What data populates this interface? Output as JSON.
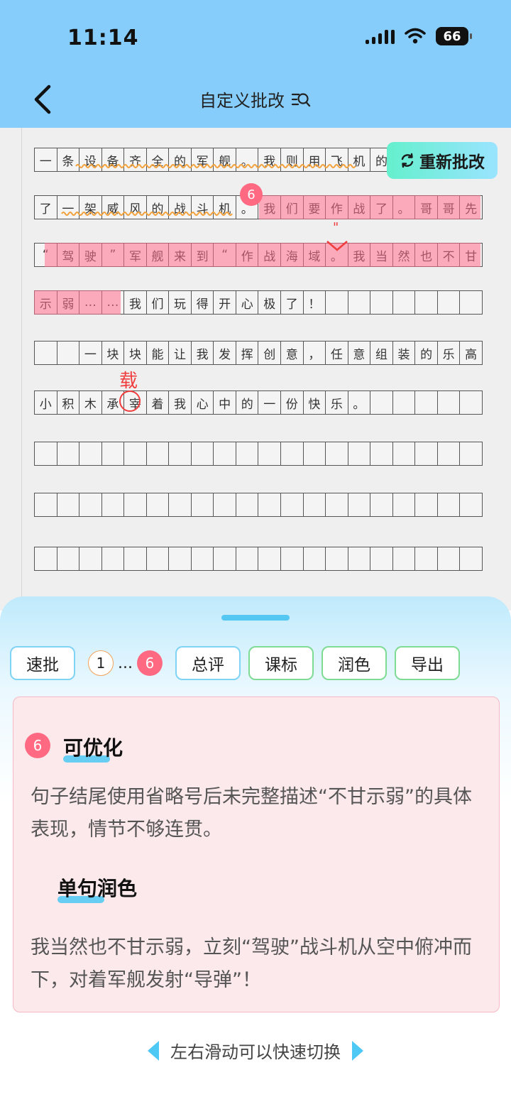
{
  "status_bar": {
    "time": "11:14",
    "battery": "66"
  },
  "header": {
    "title": "自定义批改"
  },
  "photo": {
    "regrade_label": "重新批改",
    "badge": "6",
    "correction_char": "载",
    "rows": [
      [
        "一",
        "条",
        "设",
        "备",
        "齐",
        "全",
        "的",
        "军",
        "舰",
        "。",
        "我",
        "则",
        "用",
        "飞",
        "机",
        "的",
        "",
        "",
        "",
        ""
      ],
      [
        "了",
        "一",
        "架",
        "威",
        "风",
        "的",
        "战",
        "斗",
        "机",
        "。",
        "我",
        "们",
        "要",
        "作",
        "战",
        "了",
        "。",
        "哥",
        "哥",
        "先"
      ],
      [
        "“",
        "驾",
        "驶",
        "”",
        "军",
        "舰",
        "来",
        "到",
        "“",
        "作",
        "战",
        "海",
        "域",
        "。",
        "我",
        "当",
        "然",
        "也",
        "不",
        "甘"
      ],
      [
        "示",
        "弱",
        "…",
        "…",
        "我",
        "们",
        "玩",
        "得",
        "开",
        "心",
        "极",
        "了",
        "！",
        "",
        "",
        "",
        "",
        "",
        "",
        ""
      ],
      [
        "",
        "",
        "一",
        "块",
        "块",
        "能",
        "让",
        "我",
        "发",
        "挥",
        "创",
        "意",
        "，",
        "任",
        "意",
        "组",
        "装",
        "的",
        "乐",
        "高"
      ],
      [
        "小",
        "积",
        "木",
        "承",
        "宰",
        "着",
        "我",
        "心",
        "中",
        "的",
        "一",
        "份",
        "快",
        "乐",
        "。",
        "",
        "",
        "",
        "",
        ""
      ],
      [
        "",
        "",
        "",
        "",
        "",
        "",
        "",
        "",
        "",
        "",
        "",
        "",
        "",
        "",
        "",
        "",
        "",
        "",
        "",
        ""
      ],
      [
        "",
        "",
        "",
        "",
        "",
        "",
        "",
        "",
        "",
        "",
        "",
        "",
        "",
        "",
        "",
        "",
        "",
        "",
        "",
        ""
      ],
      [
        "",
        "",
        "",
        "",
        "",
        "",
        "",
        "",
        "",
        "",
        "",
        "",
        "",
        "",
        "",
        "",
        "",
        "",
        "",
        ""
      ]
    ]
  },
  "tabs": {
    "quick": "速批",
    "first_num": "1",
    "ellipsis": "...",
    "current_num": "6",
    "summary": "总评",
    "standard": "课标",
    "polish": "润色",
    "export": "导出"
  },
  "card": {
    "badge": "6",
    "heading1": "可优化",
    "text1": "句子结尾使用省略号后未完整描述“不甘示弱”的具体表现，情节不够连贯。",
    "heading2": "单句润色",
    "text2": "我当然也不甘示弱，立刻“驾驶”战斗机从空中俯冲而下，对着军舰发射“导弹”！"
  },
  "hint": "左右滑动可以快速切换",
  "colors": {
    "header_bg": "#86cdfb",
    "badge_red": "#ff6a82",
    "accent_blue": "#4ec8f5",
    "card_bg": "#fce9ec"
  }
}
